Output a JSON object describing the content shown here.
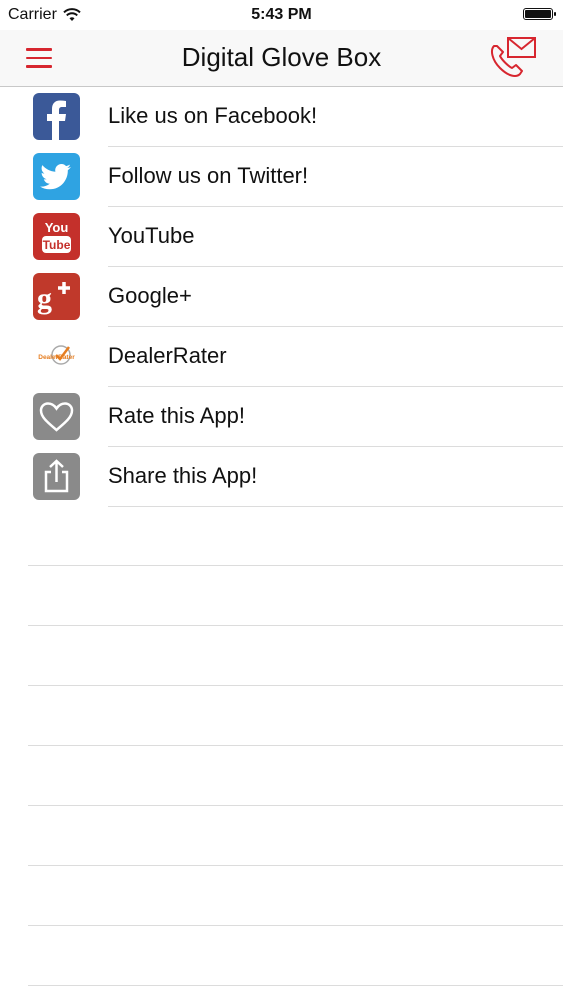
{
  "status_bar": {
    "carrier": "Carrier",
    "time": "5:43 PM"
  },
  "nav": {
    "title": "Digital Glove Box",
    "accent_color": "#d7262f"
  },
  "items": [
    {
      "label": "Like us on Facebook!",
      "icon": "facebook-icon"
    },
    {
      "label": "Follow us on Twitter!",
      "icon": "twitter-icon"
    },
    {
      "label": "YouTube",
      "icon": "youtube-icon",
      "icon_text_top": "You",
      "icon_text_bottom": "Tube"
    },
    {
      "label": "Google+",
      "icon": "google-plus-icon"
    },
    {
      "label": "DealerRater",
      "icon": "dealerrater-icon",
      "icon_text": "DealerRater"
    },
    {
      "label": "Rate this App!",
      "icon": "heart-icon"
    },
    {
      "label": "Share this App!",
      "icon": "share-icon"
    }
  ]
}
